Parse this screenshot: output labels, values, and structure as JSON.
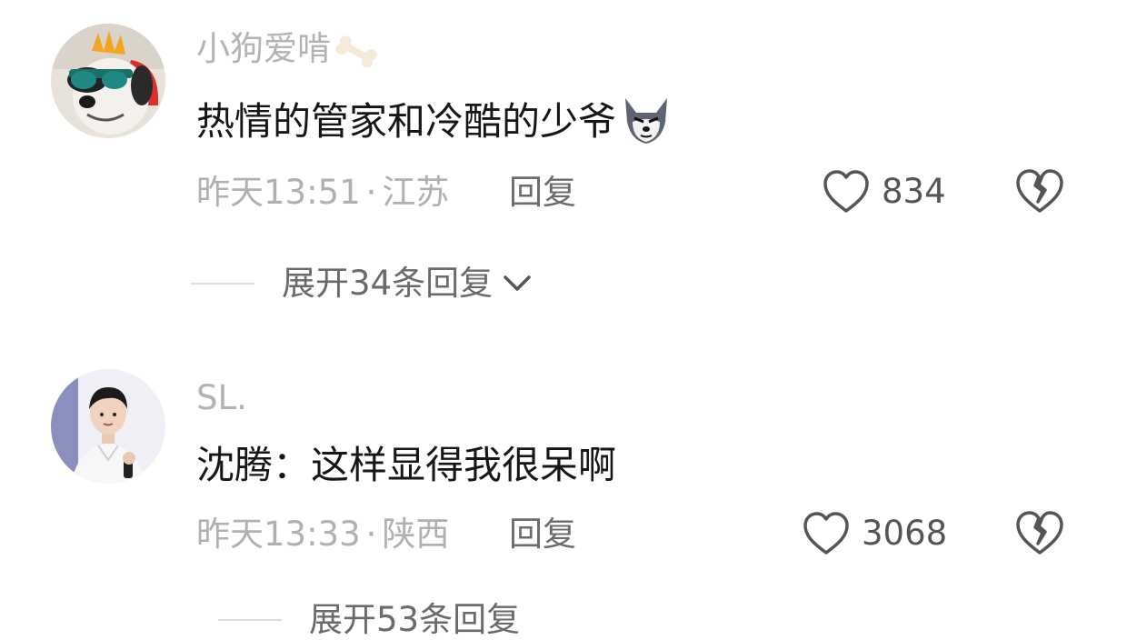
{
  "comments": [
    {
      "username": "小狗爱啃",
      "username_decoration_icon": "bone-icon",
      "text": "热情的管家和冷酷的少爷",
      "text_emoji_icon": "wolf-face-icon",
      "time": "昨天13:51",
      "separator": "·",
      "location": "江苏",
      "reply_label": "回复",
      "like_count": "834",
      "expand_label": "展开34条回复"
    },
    {
      "username": "SL.",
      "text": "沈腾：这样显得我很呆啊",
      "time": "昨天13:33",
      "separator": "·",
      "location": "陕西",
      "reply_label": "回复",
      "like_count": "3068",
      "expand_label": "展开53条回复"
    }
  ],
  "colors": {
    "username": "#b3b3b3",
    "comment_text": "#161616",
    "meta": "#b0b0b0",
    "reply": "#6b6b6b",
    "icon_stroke": "#555555"
  }
}
